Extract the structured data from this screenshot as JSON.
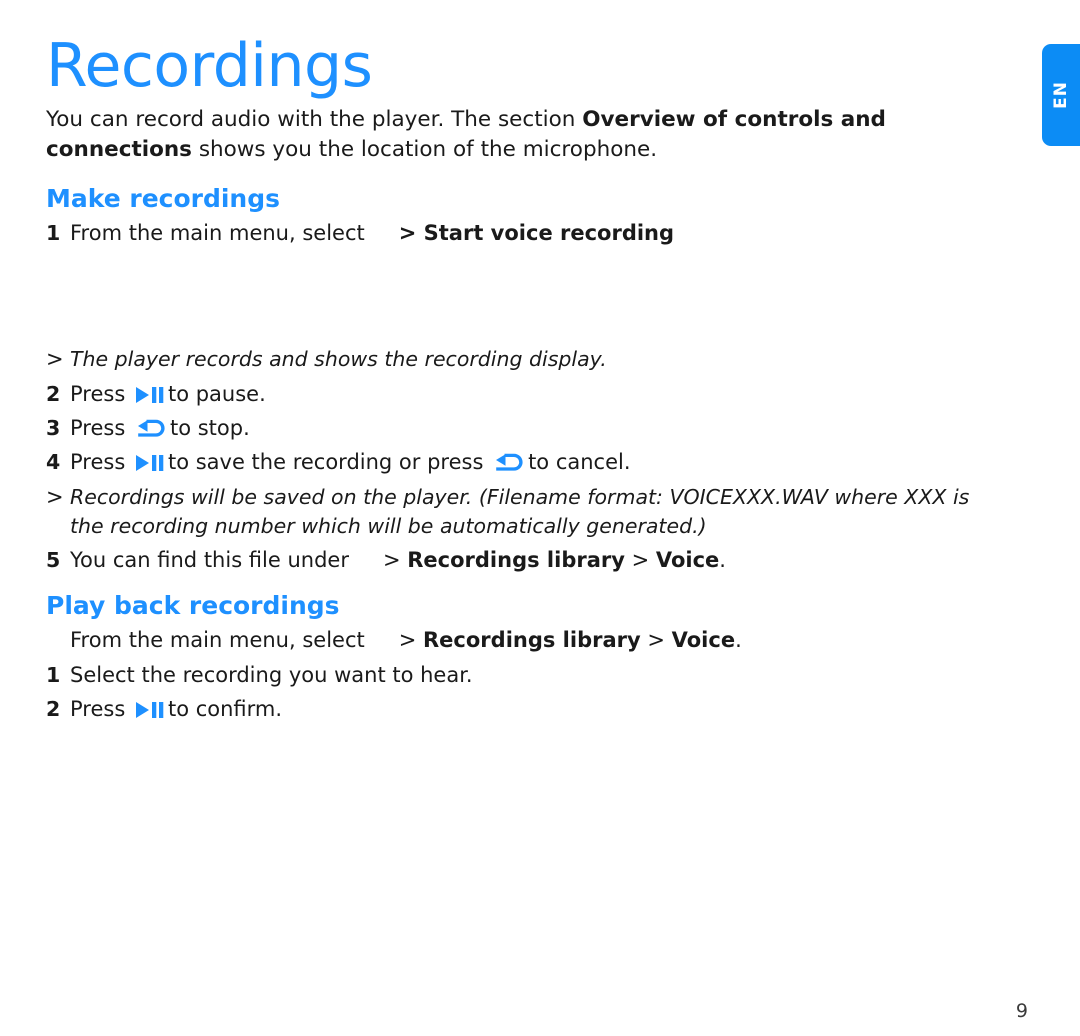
{
  "document": {
    "title": "Recordings",
    "page_number": "9",
    "language_tab": "EN",
    "accent_color": "#1e90ff",
    "tab_color": "#0c8cf5",
    "text_color": "#1a1a1a"
  },
  "intro": {
    "part1": "You can record audio with the player. The section ",
    "bold": "Overview of controls and connections",
    "part2": " shows you the location of the microphone."
  },
  "sections": [
    {
      "heading": "Make recordings",
      "lines": [
        {
          "marker": "1",
          "type": "step",
          "text_before": "From the main menu, select",
          "has_menu_icon": true,
          "menu_path": "> Start voice recording"
        },
        {
          "marker": ">",
          "type": "note",
          "text": "The player records and shows the recording display."
        },
        {
          "marker": "2",
          "type": "step-icon",
          "text_before": "Press",
          "icon": "play-pause-icon",
          "text_after": "to pause."
        },
        {
          "marker": "3",
          "type": "step-icon",
          "text_before": "Press",
          "icon": "back-arrow-icon",
          "text_after": "to stop."
        },
        {
          "marker": "4",
          "type": "step-two-icon",
          "text_before": "Press",
          "icon1": "play-pause-icon",
          "text_middle": "to save the recording or press",
          "icon2": "back-arrow-icon",
          "text_after": "to cancel."
        },
        {
          "marker": ">",
          "type": "note",
          "text": "Recordings will be saved on the player. (Filename format: VOICEXXX.WAV where XXX is the recording number which will be automatically generated.)"
        },
        {
          "marker": "5",
          "type": "step",
          "text_before": "You can find this file under",
          "has_menu_icon": true,
          "menu_path_prefix": "> ",
          "menu_bold1": "Recordings library",
          "menu_sep": " > ",
          "menu_bold2": "Voice",
          "menu_suffix": "."
        }
      ]
    },
    {
      "heading": "Play back recordings",
      "lines": [
        {
          "marker": "",
          "type": "plain-menu",
          "text_before": "From the main menu, select",
          "has_menu_icon": true,
          "menu_path_prefix": "> ",
          "menu_bold1": "Recordings library",
          "menu_sep": " > ",
          "menu_bold2": "Voice",
          "menu_suffix": "."
        },
        {
          "marker": "1",
          "type": "step-plain",
          "text": "Select the recording you want to hear."
        },
        {
          "marker": "2",
          "type": "step-icon",
          "text_before": "Press",
          "icon": "play-pause-icon",
          "text_after": "to confirm."
        }
      ]
    }
  ]
}
